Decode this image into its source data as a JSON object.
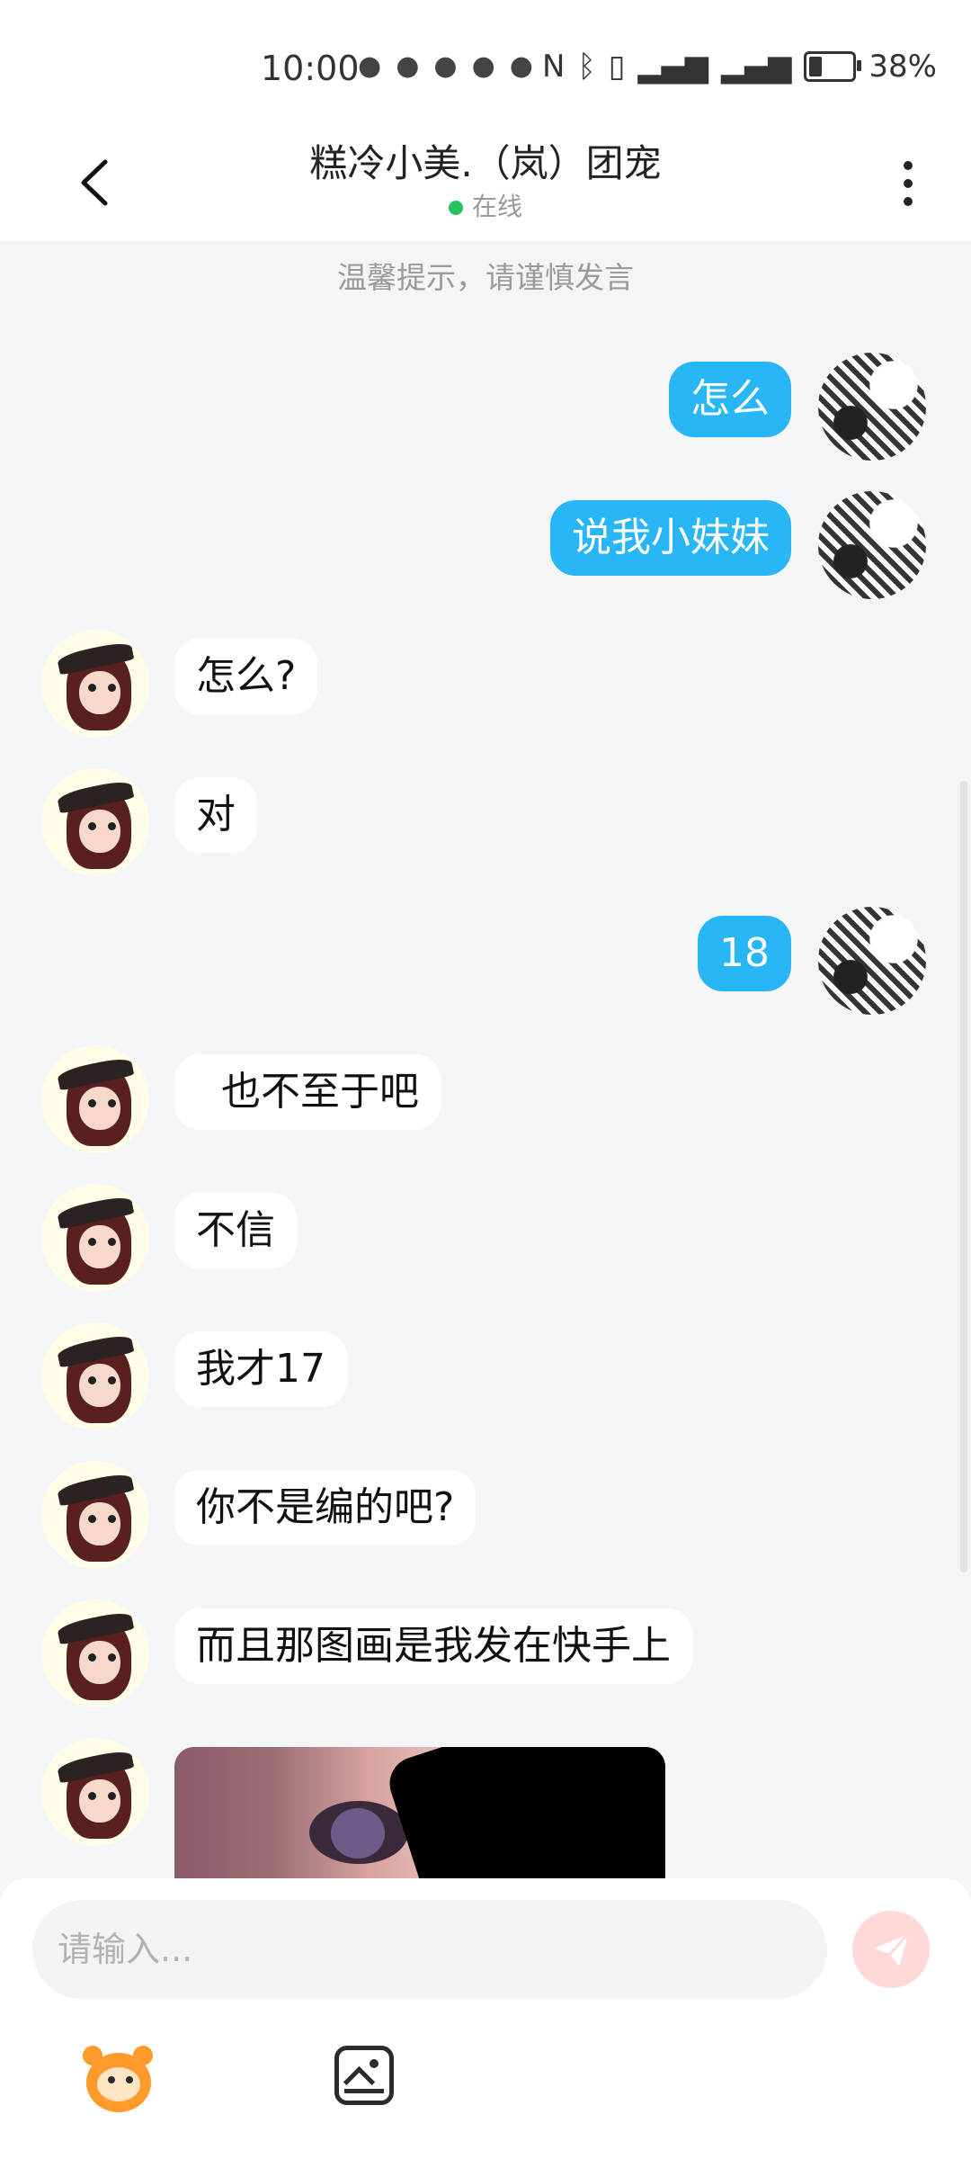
{
  "status_bar": {
    "time": "10:00",
    "battery": "38%",
    "notification_icons": [
      "wechat-icon",
      "baidu-icon",
      "music-icon",
      "browser-icon",
      "chat-icon"
    ],
    "system_icons": [
      "nfc-icon",
      "bluetooth-icon",
      "vibrate-icon",
      "signal-4g-icon",
      "signal-4g-icon",
      "battery-icon"
    ]
  },
  "header": {
    "title": "糕冷小美.（岚）团宠",
    "status": "在线"
  },
  "chat": {
    "tip": "温馨提示，请谨慎发言",
    "messages": [
      {
        "sender": "me",
        "text": "怎么"
      },
      {
        "sender": "me",
        "text": "说我小妹妹"
      },
      {
        "sender": "her",
        "text": "怎么?"
      },
      {
        "sender": "her",
        "text": "对"
      },
      {
        "sender": "me",
        "text": "18"
      },
      {
        "sender": "her",
        "text": "  也不至于吧"
      },
      {
        "sender": "her",
        "text": "不信"
      },
      {
        "sender": "her",
        "text": "我才17"
      },
      {
        "sender": "her",
        "text": "你不是编的吧?"
      },
      {
        "sender": "her",
        "text": "而且那图画是我发在快手上"
      },
      {
        "sender": "her",
        "type": "image"
      }
    ]
  },
  "input": {
    "placeholder": "请输入..."
  },
  "colors": {
    "my_bubble": "#29b6f6",
    "her_bubble": "#ffffff",
    "online_dot": "#27c25f",
    "send_button_bg": "#ffd8d8"
  }
}
